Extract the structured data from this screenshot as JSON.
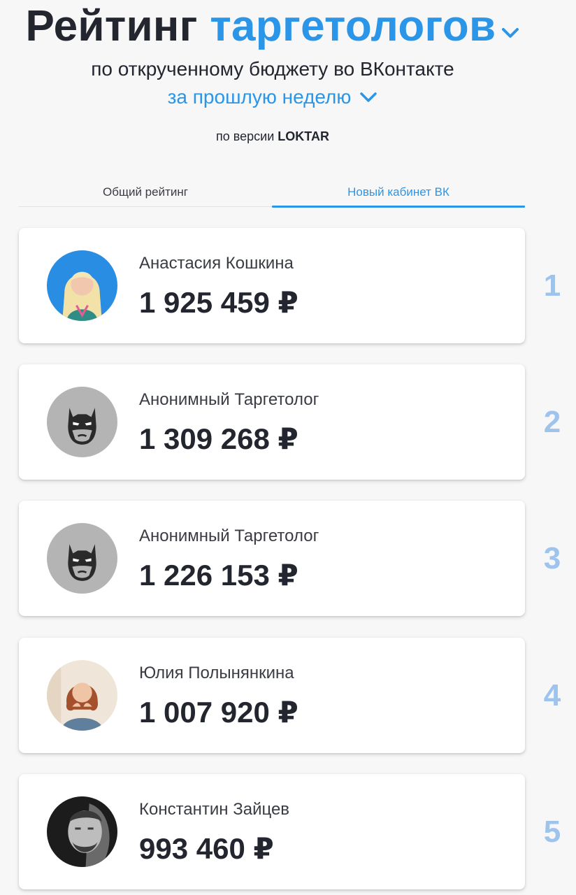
{
  "header": {
    "title_main": "Рейтинг",
    "title_accent": "таргетологов",
    "subtitle": "по открученному бюджету во ВКонтакте",
    "period": "за прошлую неделю",
    "version_prefix": "по версии",
    "version_brand": "LOKTAR"
  },
  "tabs": [
    {
      "label": "Общий рейтинг",
      "active": false
    },
    {
      "label": "Новый кабинет ВК",
      "active": true
    }
  ],
  "ranking": [
    {
      "rank": "1",
      "name": "Анастасия Кошкина",
      "amount": "1 925 459 ₽",
      "avatar": "photo-blonde-woman"
    },
    {
      "rank": "2",
      "name": "Анонимный Таргетолог",
      "amount": "1 309 268 ₽",
      "avatar": "batman-icon"
    },
    {
      "rank": "3",
      "name": "Анонимный Таргетолог",
      "amount": "1 226 153 ₽",
      "avatar": "batman-icon"
    },
    {
      "rank": "4",
      "name": "Юлия Полынянкина",
      "amount": "1 007 920 ₽",
      "avatar": "photo-red-haired-woman"
    },
    {
      "rank": "5",
      "name": "Константин Зайцев",
      "amount": "993 460 ₽",
      "avatar": "photo-bw-man"
    }
  ],
  "colors": {
    "accent": "#2b95e8",
    "rank": "#9ec3ec",
    "text": "#23252f",
    "background": "#f7f7f8"
  }
}
